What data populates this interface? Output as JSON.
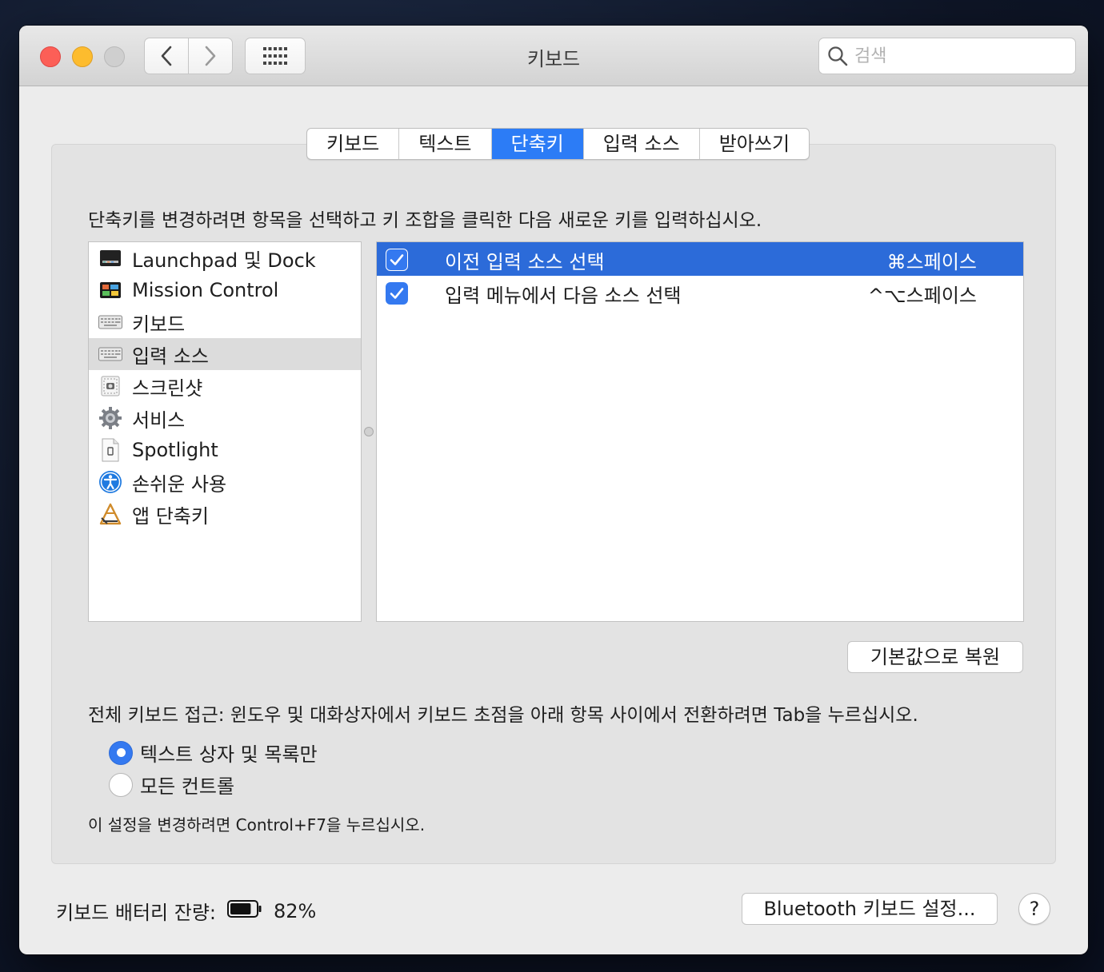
{
  "window": {
    "title": "키보드"
  },
  "search": {
    "placeholder": "검색"
  },
  "tabs": [
    {
      "label": "키보드",
      "active": false
    },
    {
      "label": "텍스트",
      "active": false
    },
    {
      "label": "단축키",
      "active": true
    },
    {
      "label": "입력 소스",
      "active": false
    },
    {
      "label": "받아쓰기",
      "active": false
    }
  ],
  "instruction": "단축키를 변경하려면 항목을 선택하고 키 조합을 클릭한 다음 새로운 키를 입력하십시오.",
  "categories": [
    {
      "label": "Launchpad 및 Dock",
      "icon": "launchpad-dock-icon",
      "selected": false
    },
    {
      "label": "Mission Control",
      "icon": "mission-control-icon",
      "selected": false
    },
    {
      "label": "키보드",
      "icon": "keyboard-icon",
      "selected": false
    },
    {
      "label": "입력 소스",
      "icon": "keyboard-icon",
      "selected": true
    },
    {
      "label": "스크린샷",
      "icon": "screenshot-icon",
      "selected": false
    },
    {
      "label": "서비스",
      "icon": "gear-icon",
      "selected": false
    },
    {
      "label": "Spotlight",
      "icon": "spotlight-icon",
      "selected": false
    },
    {
      "label": "손쉬운 사용",
      "icon": "accessibility-icon",
      "selected": false
    },
    {
      "label": "앱 단축키",
      "icon": "app-shortcuts-icon",
      "selected": false
    }
  ],
  "shortcuts": [
    {
      "label": "이전 입력 소스 선택",
      "keys": "⌘스페이스",
      "checked": true,
      "selected": true
    },
    {
      "label": "입력 메뉴에서 다음 소스 선택",
      "keys": "^⌥스페이스",
      "checked": true,
      "selected": false
    }
  ],
  "restore_button": "기본값으로 복원",
  "full_keyboard_access": {
    "description": "전체 키보드 접근: 윈도우 및 대화상자에서 키보드 초점을 아래 항목 사이에서 전환하려면 Tab을 누르십시오.",
    "options": [
      {
        "label": "텍스트 상자 및 목록만",
        "selected": true
      },
      {
        "label": "모든 컨트롤",
        "selected": false
      }
    ],
    "hint": "이 설정을 변경하려면 Control+F7을 누르십시오."
  },
  "battery": {
    "label": "키보드 배터리 잔량:",
    "value": "82%",
    "level": 0.82
  },
  "bluetooth_button": "Bluetooth 키보드 설정...",
  "help_button": "?",
  "colors": {
    "accent": "#2c7cf6",
    "selection": "#2c6bd9",
    "close": "#fc5f57",
    "minimize": "#fdbc2e"
  }
}
